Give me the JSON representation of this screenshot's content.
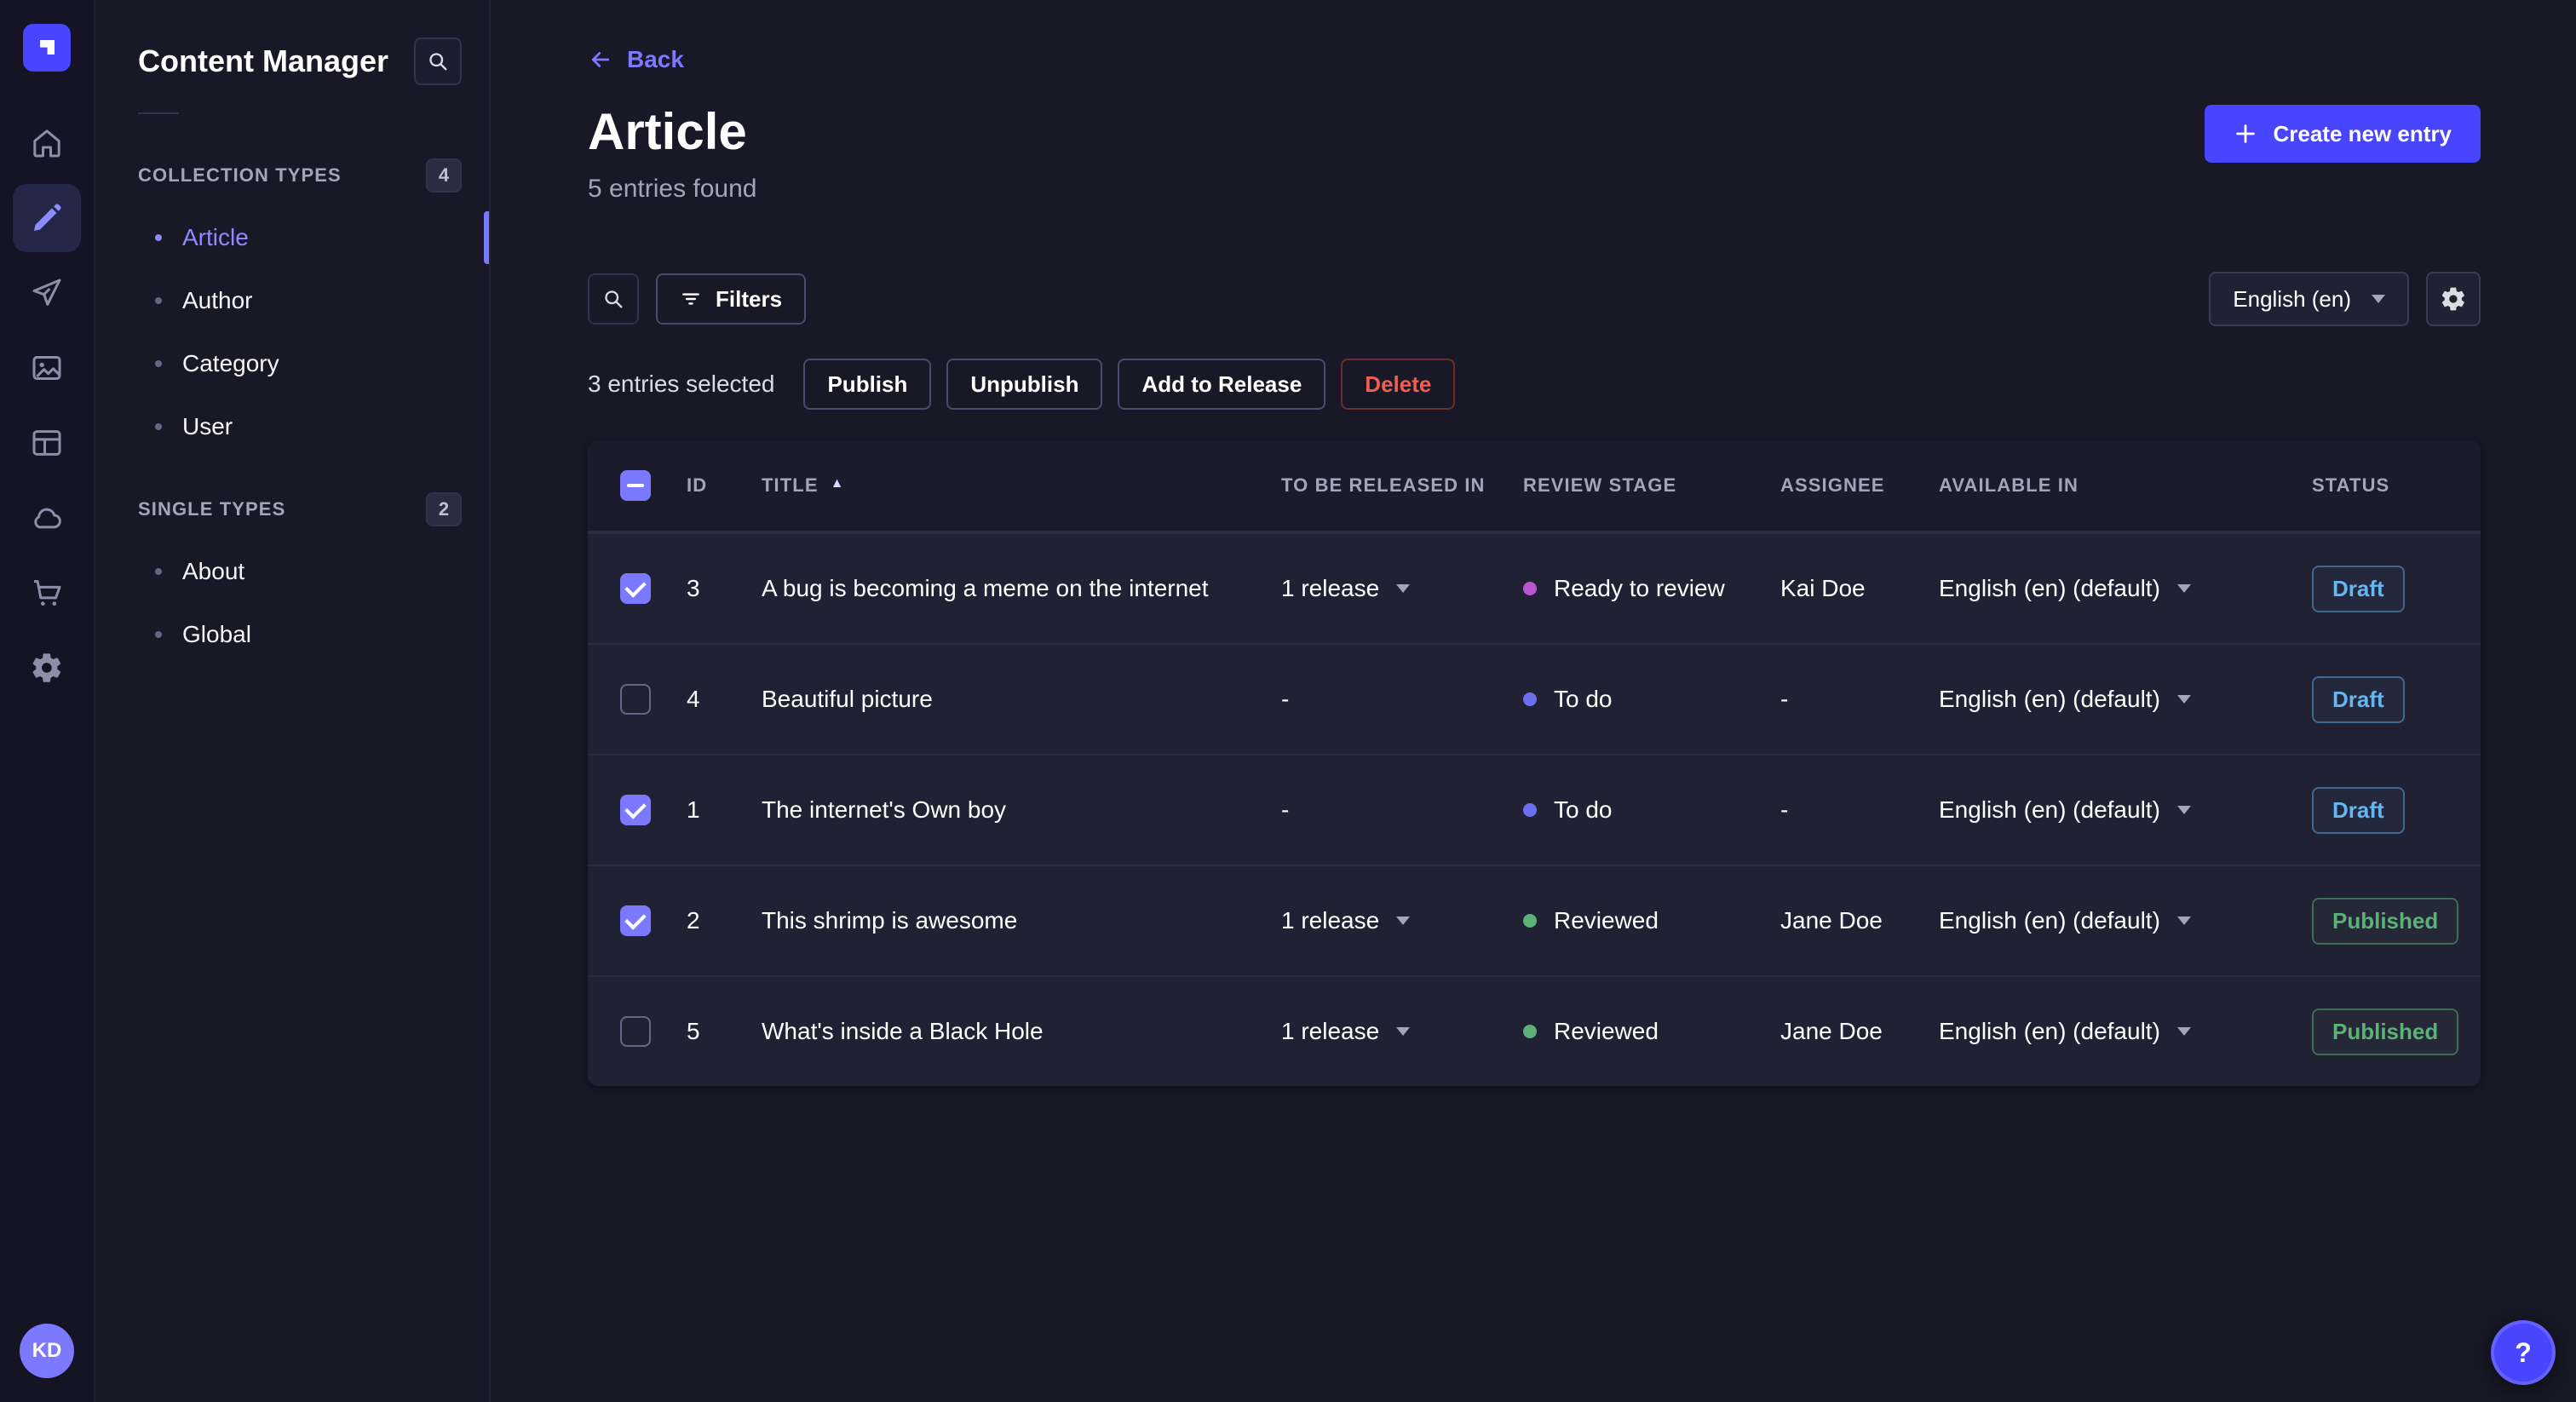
{
  "rail": {
    "avatar_initials": "KD",
    "help_label": "?"
  },
  "sidebar": {
    "title": "Content Manager",
    "sections": [
      {
        "label": "COLLECTION TYPES",
        "badge": "4",
        "items": [
          {
            "label": "Article",
            "active": true
          },
          {
            "label": "Author",
            "active": false
          },
          {
            "label": "Category",
            "active": false
          },
          {
            "label": "User",
            "active": false
          }
        ]
      },
      {
        "label": "SINGLE TYPES",
        "badge": "2",
        "items": [
          {
            "label": "About",
            "active": false
          },
          {
            "label": "Global",
            "active": false
          }
        ]
      }
    ]
  },
  "header": {
    "back_label": "Back",
    "title": "Article",
    "subtitle": "5 entries found",
    "create_button": "Create new entry"
  },
  "toolbar": {
    "filters_label": "Filters",
    "locale": "English (en)"
  },
  "selection": {
    "text": "3 entries selected",
    "publish": "Publish",
    "unpublish": "Unpublish",
    "add_to_release": "Add to Release",
    "delete": "Delete"
  },
  "table": {
    "columns": {
      "id": "ID",
      "title": "TITLE",
      "release": "TO BE RELEASED IN",
      "review_stage": "REVIEW STAGE",
      "assignee": "ASSIGNEE",
      "available_in": "AVAILABLE IN",
      "status": "STATUS"
    },
    "sort": {
      "column": "TITLE",
      "direction": "ascending"
    },
    "rows": [
      {
        "checked": true,
        "id": "3",
        "title": "A bug is becoming a meme on the internet",
        "release": "1 release",
        "review_stage": "Ready to review",
        "stage_color": "#b857d6",
        "assignee": "Kai Doe",
        "available_in": "English (en) (default)",
        "status": "Draft"
      },
      {
        "checked": false,
        "id": "4",
        "title": "Beautiful picture",
        "release": "-",
        "review_stage": "To do",
        "stage_color": "#6c6ff0",
        "assignee": "-",
        "available_in": "English (en) (default)",
        "status": "Draft"
      },
      {
        "checked": true,
        "id": "1",
        "title": "The internet's Own boy",
        "release": "-",
        "review_stage": "To do",
        "stage_color": "#6c6ff0",
        "assignee": "-",
        "available_in": "English (en) (default)",
        "status": "Draft"
      },
      {
        "checked": true,
        "id": "2",
        "title": "This shrimp is awesome",
        "release": "1 release",
        "review_stage": "Reviewed",
        "stage_color": "#5cb176",
        "assignee": "Jane Doe",
        "available_in": "English (en) (default)",
        "status": "Published"
      },
      {
        "checked": false,
        "id": "5",
        "title": "What's inside a Black Hole",
        "release": "1 release",
        "review_stage": "Reviewed",
        "stage_color": "#5cb176",
        "assignee": "Jane Doe",
        "available_in": "English (en) (default)",
        "status": "Published"
      }
    ]
  },
  "colors": {
    "primary": "#4945ff",
    "link": "#7b79ff",
    "draft": "#66b7f1",
    "published": "#5cb176",
    "danger": "#ee5e52"
  }
}
